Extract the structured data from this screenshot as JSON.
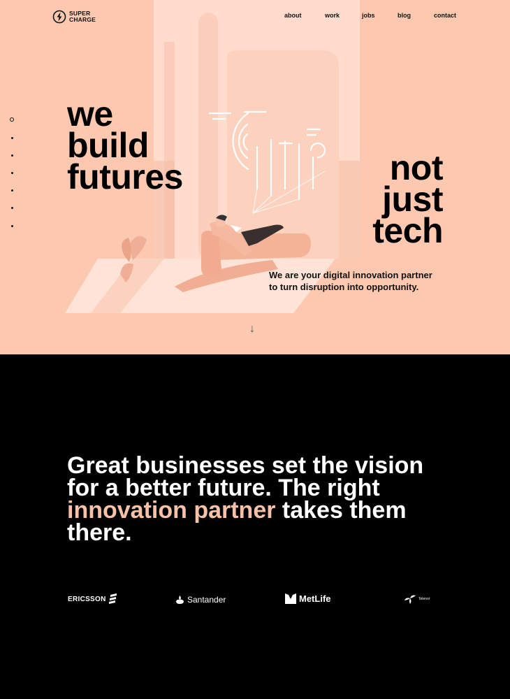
{
  "brand": {
    "line1": "SUPER",
    "line2": "CHARGE"
  },
  "nav": {
    "items": [
      "about",
      "work",
      "jobs",
      "blog",
      "contact"
    ]
  },
  "hero": {
    "headline_left": [
      "we",
      "build",
      "futures"
    ],
    "headline_right": [
      "not",
      "just",
      "tech"
    ],
    "tagline": [
      "We are your digital innovation partner",
      "to turn disruption into opportunity."
    ],
    "scroll_arrow": "↓",
    "section_dots": {
      "count": 7,
      "active_index": 0
    }
  },
  "intro": {
    "before": "Great businesses set the vision for a better future. The right ",
    "highlight": "innovation partner",
    "after": " takes them there."
  },
  "clients": [
    "ERICSSON",
    "Santander",
    "MetLife",
    "Telenor"
  ],
  "colors": {
    "hero_bg": "#fcc8b0",
    "accent": "#f6c2a7",
    "dark_bg": "#000000"
  }
}
